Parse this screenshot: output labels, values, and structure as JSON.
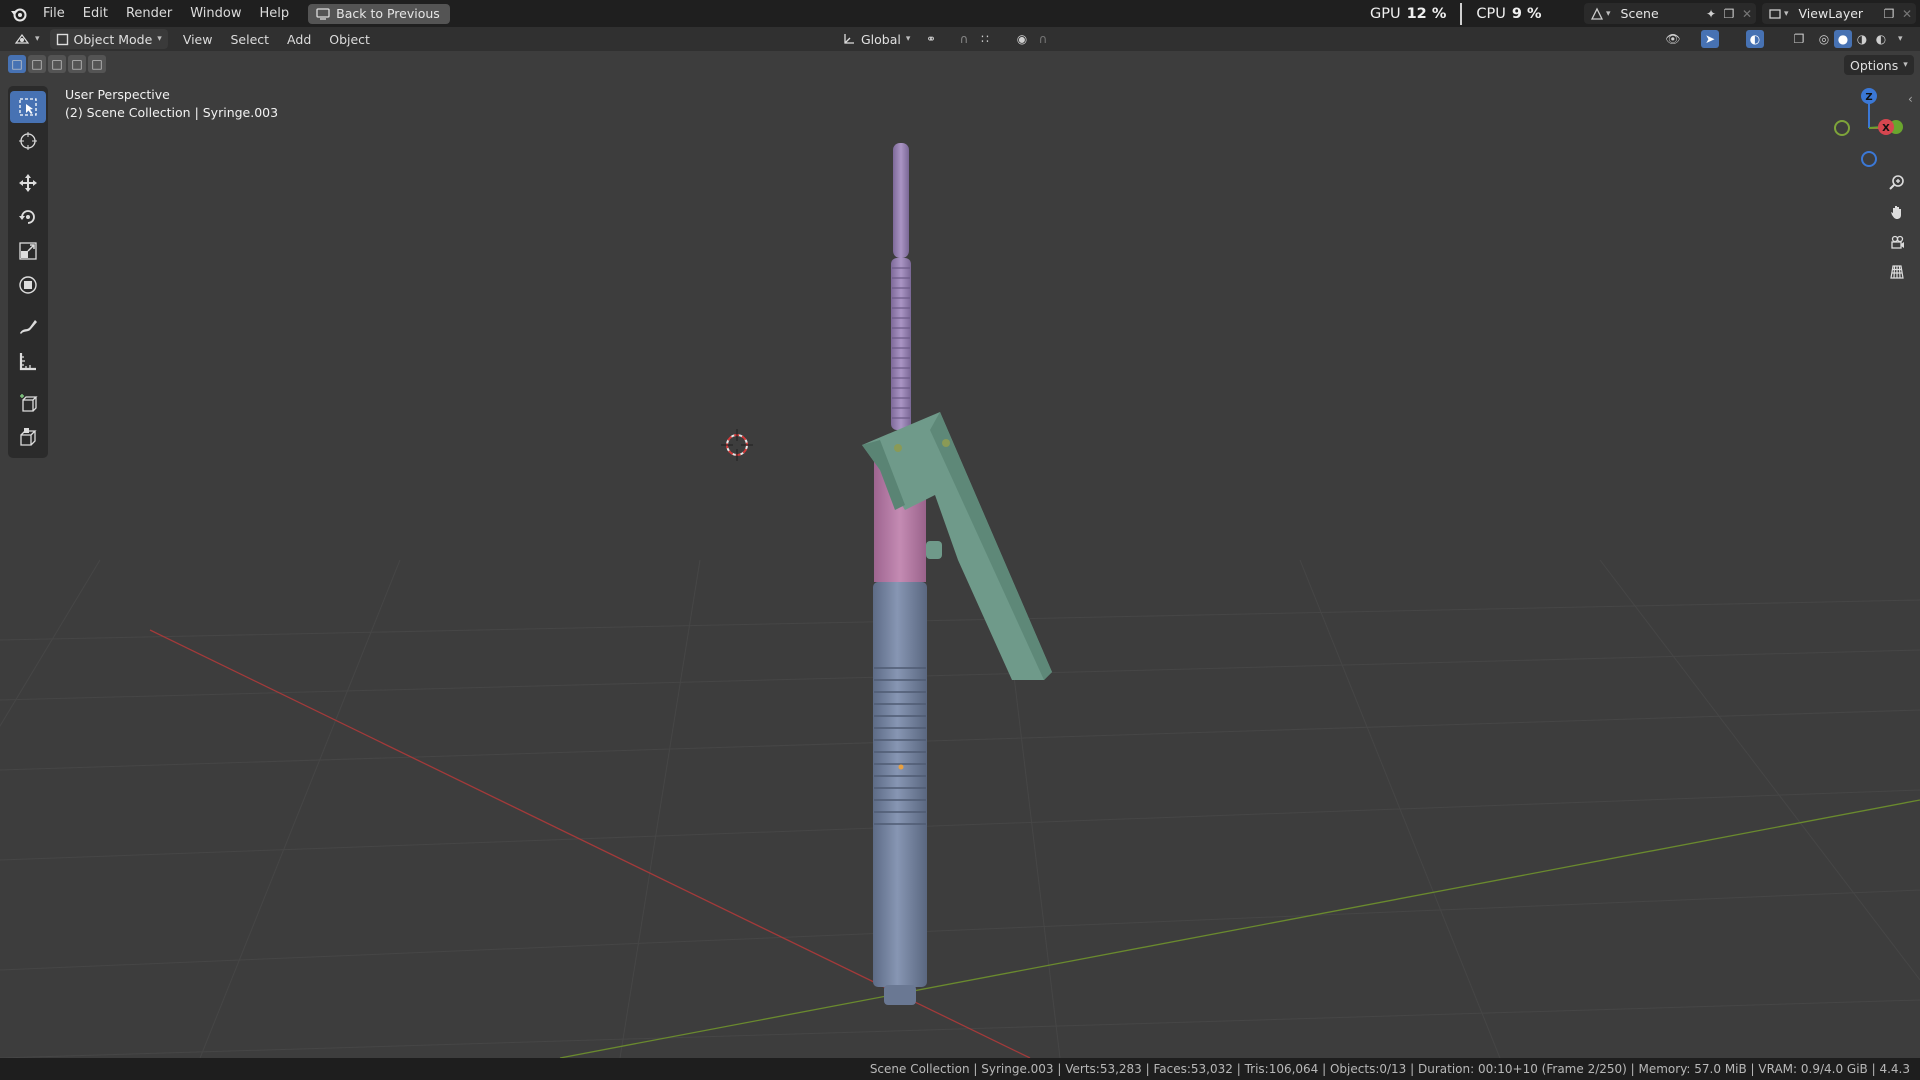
{
  "topbar": {
    "menu": [
      "File",
      "Edit",
      "Render",
      "Window",
      "Help"
    ],
    "back_button": "Back to Previous",
    "gpu_label": "GPU",
    "gpu_value": "12 %",
    "cpu_label": "CPU",
    "cpu_value": "9 %",
    "scene_name": "Scene",
    "view_layer": "ViewLayer"
  },
  "header": {
    "mode": "Object Mode",
    "menus": [
      "View",
      "Select",
      "Add",
      "Object"
    ],
    "orientation": "Global",
    "options": "Options"
  },
  "viewport": {
    "perspective": "User Perspective",
    "collection": "(2) Scene Collection | Syringe.003"
  },
  "gizmo": {
    "z": "Z",
    "x": "X"
  },
  "statusbar": {
    "text": "Scene Collection | Syringe.003 | Verts:53,283 | Faces:53,032 | Tris:106,064 | Objects:0/13 | Duration: 00:10+10 (Frame 2/250) | Memory: 57.0 MiB | VRAM: 0.9/4.0 GiB | 4.4.3"
  },
  "colors": {
    "accent": "#4772b3",
    "barrel": "#7a8aa8",
    "pink": "#b87aa6",
    "lever": "#6f9a8a",
    "plunger": "#9a86b4"
  }
}
